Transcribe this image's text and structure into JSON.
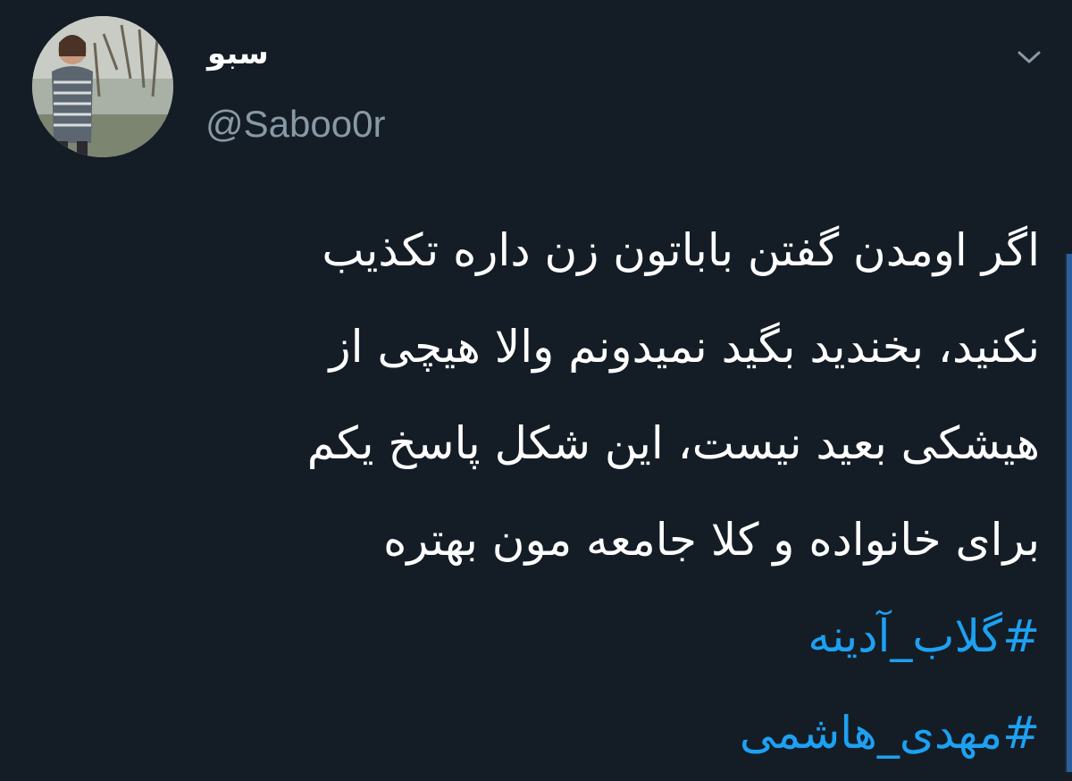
{
  "tweet": {
    "display_name": "سبو",
    "handle": "@Saboo0r",
    "avatar_icon": "profile-photo",
    "caret_icon": "chevron-down-icon",
    "text_lines": [
      "اگر اومدن گفتن باباتون زن داره تکذیب",
      "نکنید، بخندید بگید نمیدونم والا هیچی از",
      "هیشکی بعید نیست، این شکل پاسخ یکم",
      "برای خانواده و کلا جامعه مون بهتره"
    ],
    "hashtags": [
      "#گلاب_آدینه",
      "#مهدی_هاشمی"
    ]
  },
  "colors": {
    "background": "#141d26",
    "text": "#ffffff",
    "handle": "#8899a6",
    "hashtag": "#1da1f2",
    "scrollbar": "#2a5f9e"
  }
}
